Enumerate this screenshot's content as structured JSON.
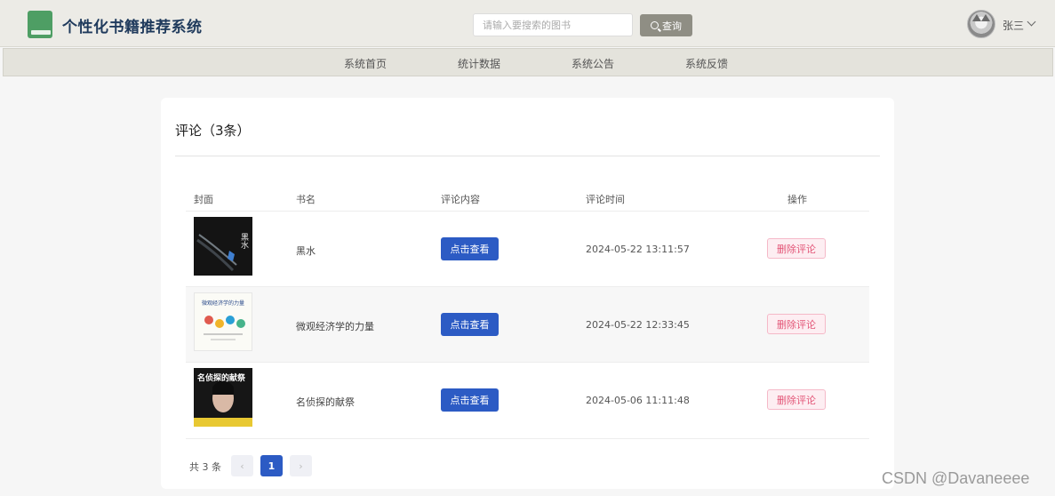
{
  "header": {
    "site_title": "个性化书籍推荐系统",
    "search_placeholder": "请输入要搜索的图书",
    "search_button": "查询",
    "username": "张三"
  },
  "nav": {
    "items": [
      {
        "label": "系统首页"
      },
      {
        "label": "统计数据"
      },
      {
        "label": "系统公告"
      },
      {
        "label": "系统反馈"
      }
    ]
  },
  "comments": {
    "title": "评论（3条）",
    "columns": [
      "封面",
      "书名",
      "评论内容",
      "评论时间",
      "操作"
    ],
    "rows": [
      {
        "book": "黑水",
        "view_label": "点击查看",
        "time": "2024-05-22 13:11:57",
        "delete_label": "删除评论",
        "cover_text": "黑水"
      },
      {
        "book": "微观经济学的力量",
        "view_label": "点击查看",
        "time": "2024-05-22 12:33:45",
        "delete_label": "删除评论",
        "cover_text": "微观经济学的力量"
      },
      {
        "book": "名侦探的献祭",
        "view_label": "点击查看",
        "time": "2024-05-06 11:11:48",
        "delete_label": "删除评论",
        "cover_text": "名侦探的献祭"
      }
    ],
    "pager": {
      "total": "共 3 条",
      "prev": "‹",
      "current": "1",
      "next": "›"
    }
  },
  "watermark": "CSDN @Davaneeee",
  "colors": {
    "primary": "#2c5bc4",
    "danger": "#e35577",
    "logo": "#4e9e64"
  }
}
